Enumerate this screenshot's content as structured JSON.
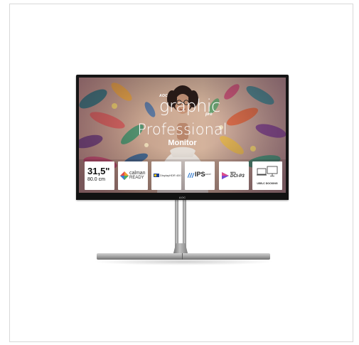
{
  "screen": {
    "brand_small": "AOC",
    "brand_main": "graphic",
    "brand_suffix": "pro",
    "headline": "Professional",
    "subline": "Monitor"
  },
  "bezel": {
    "logo": "AOC"
  },
  "badges": {
    "size": {
      "main": "31,5\"",
      "sub": "80.0 cm"
    },
    "calman": {
      "line1": "calman",
      "line2": "READY",
      "icon": "calman-diamond-icon"
    },
    "displayhdr": {
      "label": "DisplayHDR 400",
      "icon": "vesa-logo-icon"
    },
    "ips": {
      "label": "IPS",
      "sub": "panel",
      "icon": "ips-stripes-icon"
    },
    "dcip3": {
      "top": "98%",
      "label": "DCI-P3",
      "icon": "color-triangle-icon"
    },
    "usbc": {
      "label": "USB-C DOCKING",
      "icon": "laptop-monitor-icon"
    }
  },
  "colors": {
    "bezel": "#151515",
    "badge_bg": "#ffffff",
    "stand": "#a0a0a0"
  }
}
